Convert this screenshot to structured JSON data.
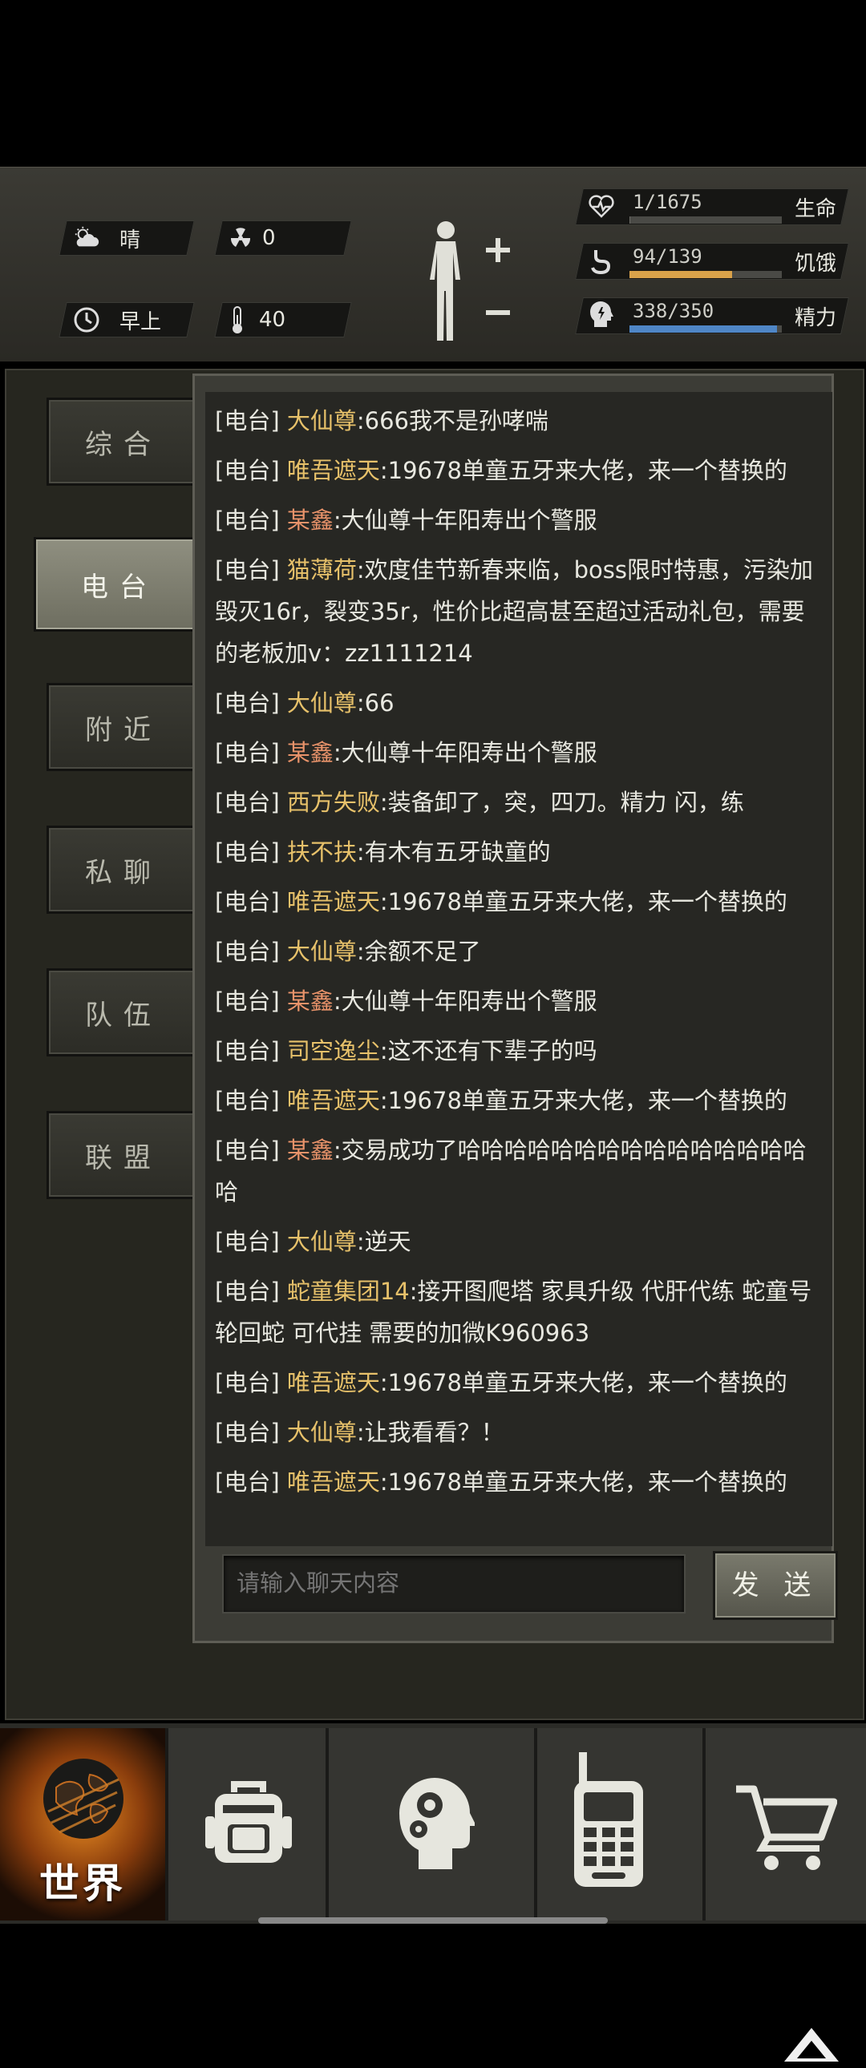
{
  "status": {
    "weather": {
      "icon": "partly-cloudy-icon",
      "label": "晴"
    },
    "radiation": {
      "icon": "radiation-icon",
      "value": "0"
    },
    "time_of_day": {
      "icon": "clock-icon",
      "label": "早上"
    },
    "temperature": {
      "icon": "thermometer-icon",
      "value": "40"
    }
  },
  "vitals": [
    {
      "name": "生命",
      "value": "1/1675",
      "fraction": 0.0006,
      "color": "#6b6b66",
      "icon": "heart-pulse-icon"
    },
    {
      "name": "饥饿",
      "value": "94/139",
      "fraction": 0.676,
      "color": "#d9a24a",
      "icon": "stomach-icon"
    },
    {
      "name": "精力",
      "value": "338/350",
      "fraction": 0.966,
      "color": "#4f86c6",
      "icon": "head-energy-icon"
    }
  ],
  "tabs": [
    {
      "label": "综合",
      "active": false
    },
    {
      "label": "电台",
      "active": true
    },
    {
      "label": "附近",
      "active": false
    },
    {
      "label": "私聊",
      "active": false
    },
    {
      "label": "队伍",
      "active": false
    },
    {
      "label": "联盟",
      "active": false
    }
  ],
  "messages": [
    {
      "channel": "[电台]",
      "name": "大仙尊",
      "tone": "y",
      "text": ":666我不是孙哮喘"
    },
    {
      "channel": "[电台]",
      "name": "唯吾遮天",
      "tone": "y",
      "text": ":19678单童五牙来大佬，来一个替换的"
    },
    {
      "channel": "[电台]",
      "name": "某鑫",
      "tone": "o",
      "text": ":大仙尊十年阳寿出个警服"
    },
    {
      "channel": "[电台]",
      "name": "猫薄荷",
      "tone": "y",
      "text": ":欢度佳节新春来临，boss限时特惠，污染加毁灭16r，裂变35r，性价比超高甚至超过活动礼包，需要的老板加v：zz1111214"
    },
    {
      "channel": "[电台]",
      "name": "大仙尊",
      "tone": "y",
      "text": ":66"
    },
    {
      "channel": "[电台]",
      "name": "某鑫",
      "tone": "o",
      "text": ":大仙尊十年阳寿出个警服"
    },
    {
      "channel": "[电台]",
      "name": "西方失败",
      "tone": "y",
      "text": ":装备卸了，突，四刀。精力 闪，练"
    },
    {
      "channel": "[电台]",
      "name": "扶不扶",
      "tone": "y",
      "text": ":有木有五牙缺童的"
    },
    {
      "channel": "[电台]",
      "name": "唯吾遮天",
      "tone": "y",
      "text": ":19678单童五牙来大佬，来一个替换的"
    },
    {
      "channel": "[电台]",
      "name": "大仙尊",
      "tone": "y",
      "text": ":余额不足了"
    },
    {
      "channel": "[电台]",
      "name": "某鑫",
      "tone": "o",
      "text": ":大仙尊十年阳寿出个警服"
    },
    {
      "channel": "[电台]",
      "name": "司空逸尘",
      "tone": "y",
      "text": ":这不还有下辈子的吗"
    },
    {
      "channel": "[电台]",
      "name": "唯吾遮天",
      "tone": "y",
      "text": ":19678单童五牙来大佬，来一个替换的"
    },
    {
      "channel": "[电台]",
      "name": "某鑫",
      "tone": "o",
      "text": ":交易成功了哈哈哈哈哈哈哈哈哈哈哈哈哈哈哈哈"
    },
    {
      "channel": "[电台]",
      "name": "大仙尊",
      "tone": "y",
      "text": ":逆天"
    },
    {
      "channel": "[电台]",
      "name": "蛇童集团14",
      "tone": "y",
      "text": ":接开图爬塔 家具升级 代肝代练 蛇童号 轮回蛇 可代挂 需要的加微K960963"
    },
    {
      "channel": "[电台]",
      "name": "唯吾遮天",
      "tone": "y",
      "text": ":19678单童五牙来大佬，来一个替换的"
    },
    {
      "channel": "[电台]",
      "name": "大仙尊",
      "tone": "y",
      "text": ":让我看看？！"
    },
    {
      "channel": "[电台]",
      "name": "唯吾遮天",
      "tone": "y",
      "text": ":19678单童五牙来大佬，来一个替换的"
    }
  ],
  "chat_input": {
    "placeholder": "请输入聊天内容"
  },
  "send_label": "发 送",
  "nav": {
    "world_label": "世界",
    "items": [
      {
        "icon": "globe-icon",
        "label": "世界",
        "active": true
      },
      {
        "icon": "backpack-icon",
        "active": false
      },
      {
        "icon": "head-gears-icon",
        "active": false
      },
      {
        "icon": "walkie-talkie-icon",
        "active": false
      },
      {
        "icon": "shopping-cart-icon",
        "active": false
      }
    ]
  }
}
